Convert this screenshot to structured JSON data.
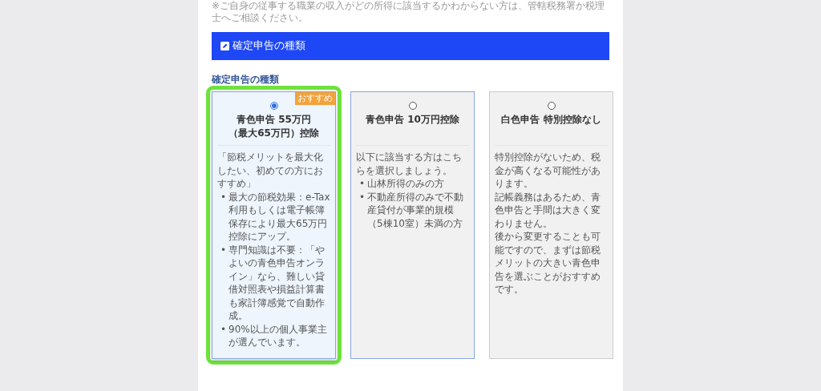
{
  "note": "※ご自身の従事する職業の収入がどの所得に該当するかわからない方は、管轄税務署か税理士へご相談ください。",
  "section_header": {
    "title": "確定申告の種類"
  },
  "field_label": "確定申告の種類",
  "options": [
    {
      "title": "青色申告 55万円（最大65万円）控除",
      "selected": true,
      "highlighted": true,
      "hovered": false,
      "badge": "おすすめ",
      "marker": "•",
      "intro": "「節税メリットを最大化したい、初めての方におすすめ」",
      "bullets": [
        "最大の節税効果：e-Tax利用もしくは電子帳簿保存により最大65万円控除にアップ。",
        "専門知識は不要：「やよいの青色申告オンライン」なら、難しい貸借対照表や損益計算書も家計簿感覚で自動作成。",
        "90%以上の個人事業主が選んでいます。"
      ]
    },
    {
      "title": "青色申告 10万円控除",
      "selected": false,
      "highlighted": false,
      "hovered": true,
      "marker": "•",
      "intro": "以下に該当する方はこちらを選択しましょう。",
      "bullets": [
        "山林所得のみの方",
        "不動産所得のみで不動産貸付が事業的規模（5棟10室）未満の方"
      ]
    },
    {
      "title": "白色申告 特別控除なし",
      "selected": false,
      "highlighted": false,
      "hovered": false,
      "paragraphs": [
        "特別控除がないため、税金が高くなる可能性があります。",
        "記帳義務はあるため、青色申告と手間は大きく変わりません。",
        "後から変更することも可能ですので、まずは節税メリットの大きい青色申告を選ぶことがおすすめです。"
      ]
    }
  ]
}
